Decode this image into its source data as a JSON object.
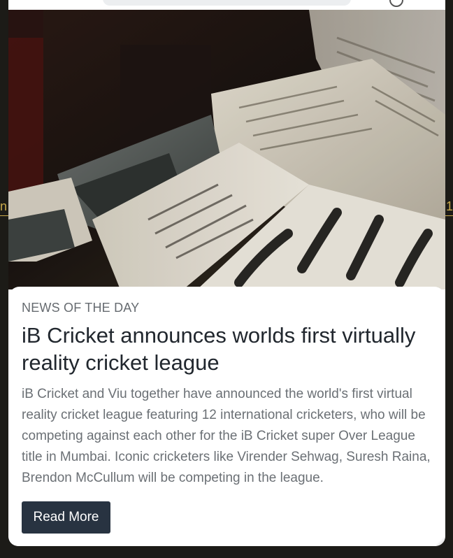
{
  "background_glyphs": {
    "left": "n",
    "right": "1"
  },
  "article": {
    "image_alt": "Stack of vintage newspapers",
    "kicker": "NEWS OF THE DAY",
    "headline": "iB Cricket announces worlds first virtually reality cricket league",
    "body": "iB Cricket and Viu together have announced the world's first virtual reality cricket league featuring 12 international cricketers, who will be competing against each other for the iB Cricket super Over League title in Mumbai. Iconic cricketers like Virender Sehwag, Suresh Raina, Brendon McCullum will be competing in the league.",
    "read_more_label": "Read More"
  },
  "colors": {
    "button_bg": "#283341",
    "headline": "#21272e",
    "body_text": "#6b7075",
    "accent_line": "#caa84a"
  }
}
